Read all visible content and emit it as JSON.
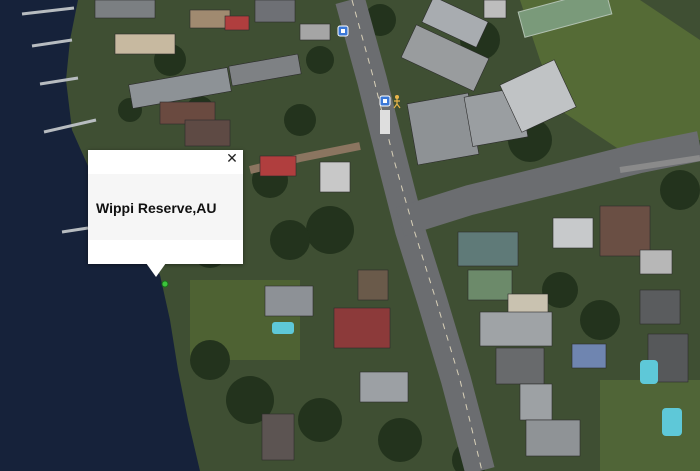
{
  "map": {
    "type": "satellite",
    "marker_color": "#3cc43c",
    "bus_stop_icon_color": "#3b78d8",
    "icons": [
      "bus-stop-icon",
      "bus-stop-icon",
      "pedestrian-icon",
      "location-marker-icon"
    ]
  },
  "infowindow": {
    "title": "Wippi Reserve,AU",
    "close_glyph": "✕"
  }
}
